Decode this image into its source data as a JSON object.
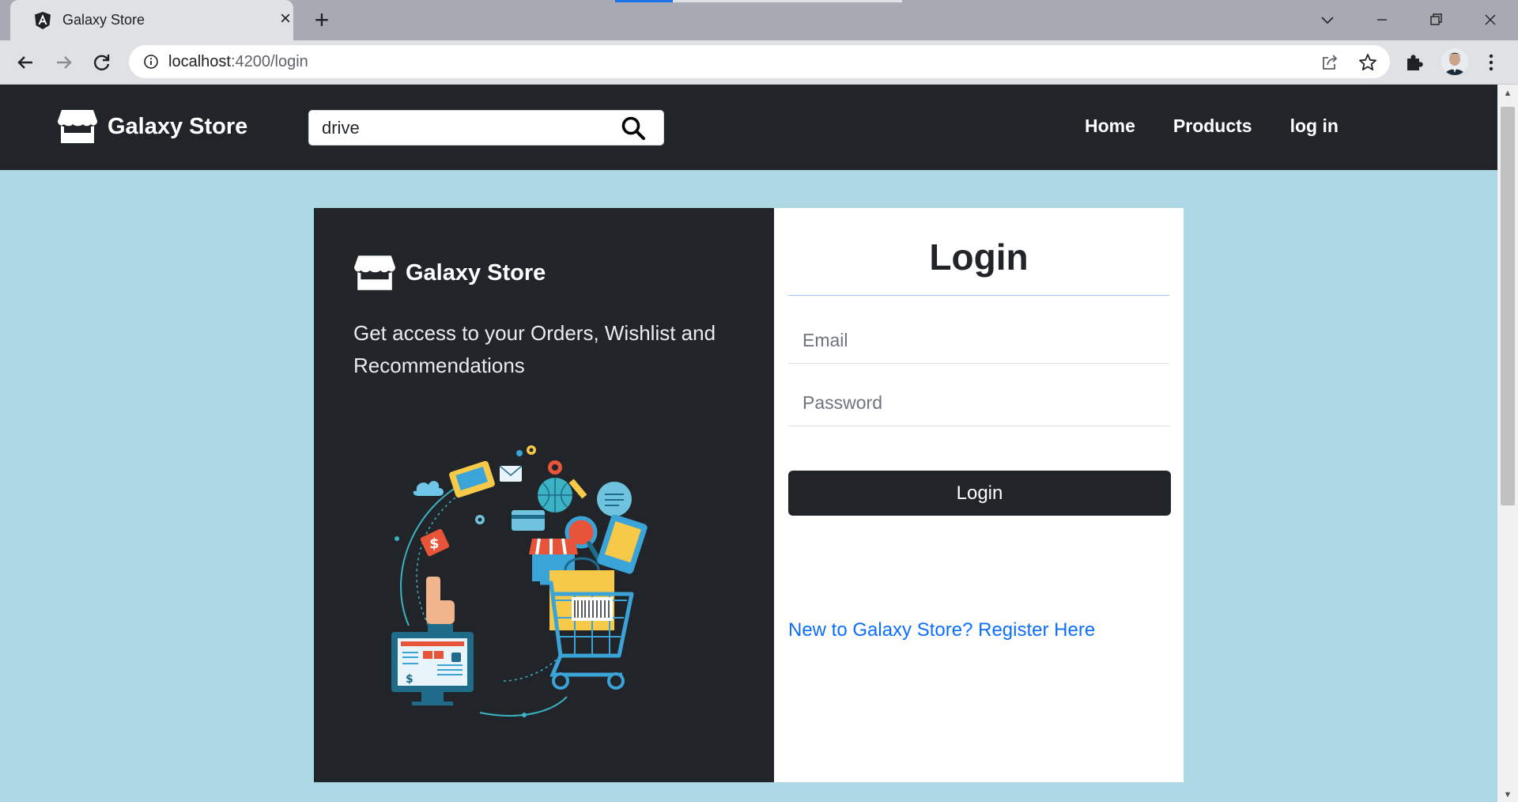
{
  "browser": {
    "tab_title": "Galaxy Store",
    "url_host": "localhost",
    "url_rest": ":4200/login",
    "icons": [
      "angular-favicon",
      "close-icon",
      "plus-icon",
      "chevron-down-icon",
      "minimize-icon",
      "restore-icon",
      "close-window-icon",
      "back-arrow-icon",
      "forward-arrow-icon",
      "reload-icon",
      "info-icon",
      "share-icon",
      "star-icon",
      "puzzle-icon",
      "avatar",
      "kebab-menu-icon"
    ]
  },
  "navbar": {
    "brand": "Galaxy Store",
    "search_value": "drive",
    "links": [
      "Home",
      "Products",
      "log in"
    ]
  },
  "promo": {
    "brand": "Galaxy Store",
    "tagline": "Get access to your Orders, Wishlist and Recommendations"
  },
  "login": {
    "title": "Login",
    "email_placeholder": "Email",
    "password_placeholder": "Password",
    "submit_label": "Login",
    "register_link": "New to Galaxy Store? Register Here"
  },
  "colors": {
    "page_bg": "#add8e6",
    "navbar_bg": "#212529",
    "link": "#0d6efd"
  }
}
